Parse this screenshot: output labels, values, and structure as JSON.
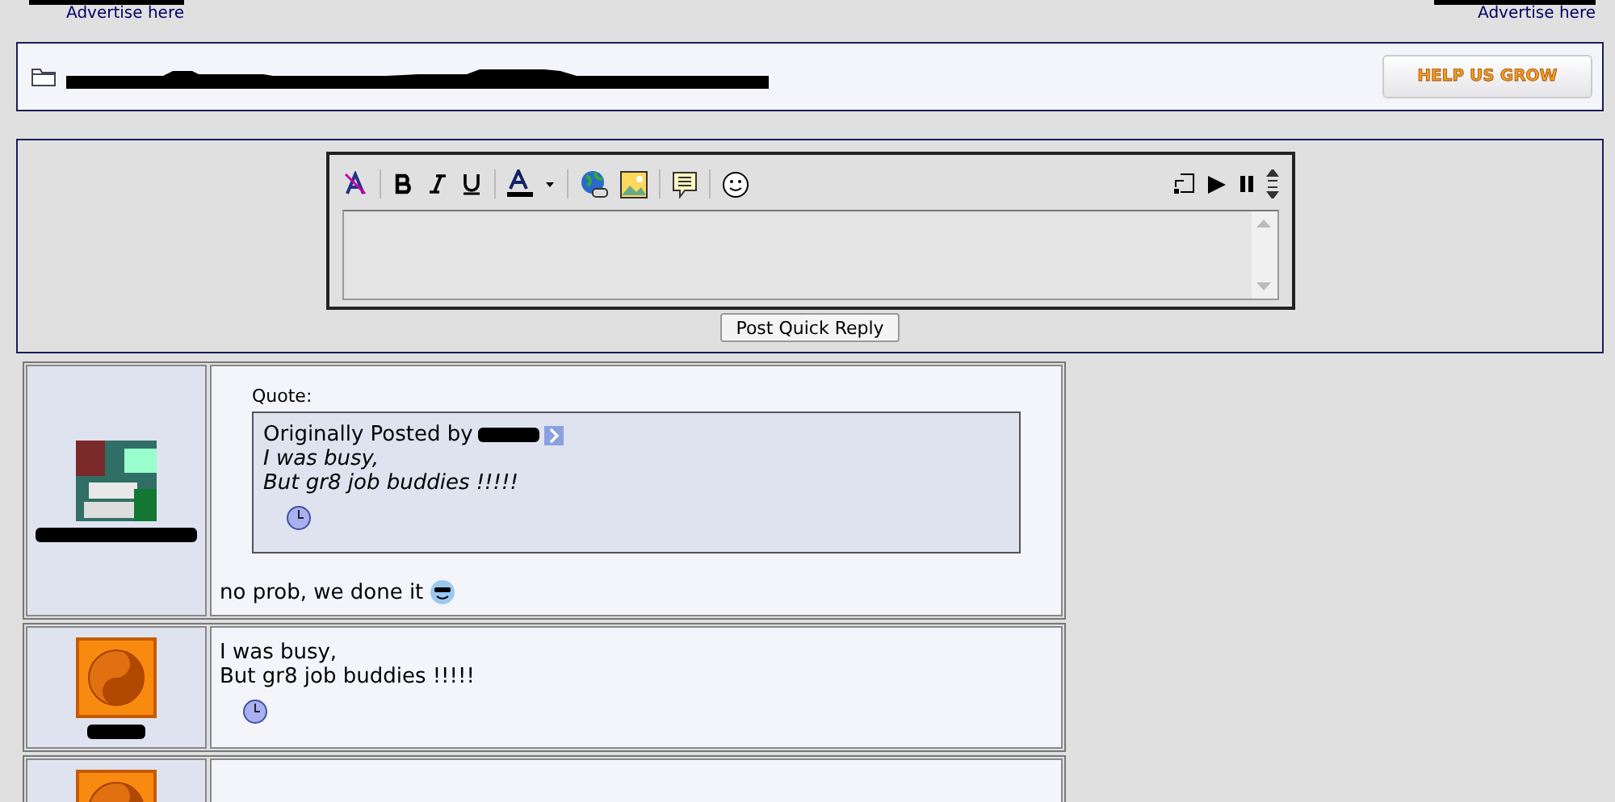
{
  "ads": [
    "Advertise here",
    "Advertise here"
  ],
  "help_button": "HELP US GROW",
  "quick_reply": {
    "submit": "Post Quick Reply"
  },
  "posts": [
    {
      "kind": "picture",
      "quote": {
        "heading": "Quote:",
        "prefix": "Originally Posted by",
        "lines": [
          "I was busy,",
          "But gr8 job buddies !!!!!"
        ]
      },
      "lines": [
        "no prob, we done it"
      ],
      "emoticon": true
    },
    {
      "kind": "yinyang",
      "lines": [
        "I was busy,",
        "But gr8 job buddies !!!!!"
      ]
    },
    {
      "kind": "yinyang"
    }
  ]
}
